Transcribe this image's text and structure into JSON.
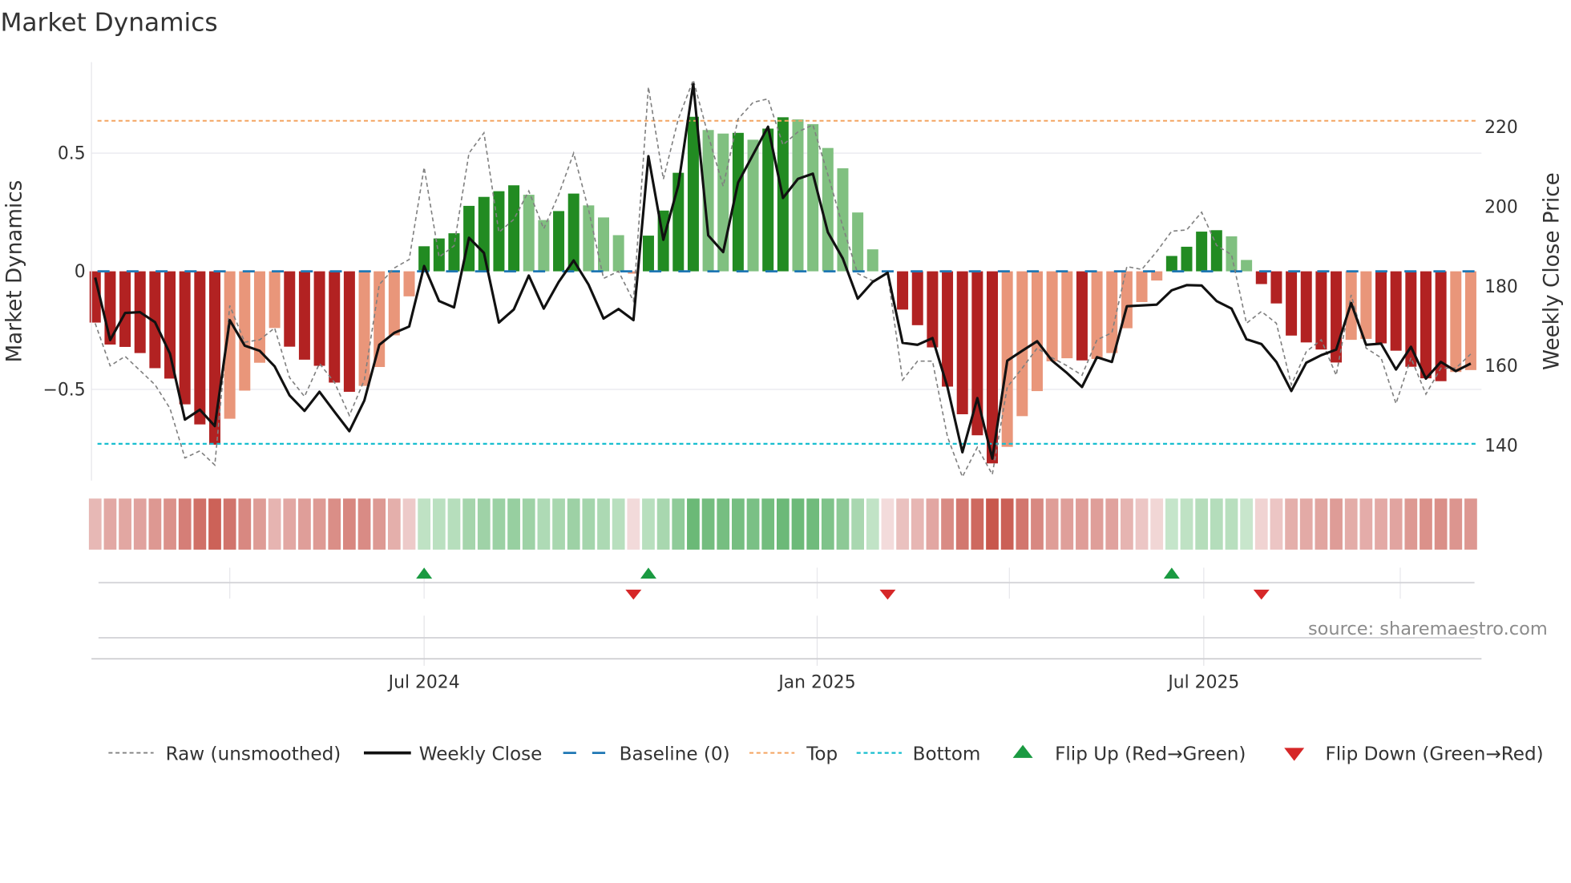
{
  "title": "Market Dynamics",
  "source": "source: sharemaestro.com",
  "colors": {
    "bar_neg_strong": "#b22222",
    "bar_neg_weak": "#e9967a",
    "bar_pos_strong": "#228b22",
    "bar_pos_weak": "#80c080",
    "baseline": "#1f77b4",
    "top": "#f4a460",
    "bottom": "#17becf",
    "close": "#111111",
    "raw": "#808080",
    "flip_up": "#1a9a41",
    "flip_down": "#d62728"
  },
  "legend": [
    {
      "key": "raw",
      "label": "Raw (unsmoothed)"
    },
    {
      "key": "close",
      "label": "Weekly Close"
    },
    {
      "key": "baseline",
      "label": "Baseline (0)"
    },
    {
      "key": "top",
      "label": "Top"
    },
    {
      "key": "bottom",
      "label": "Bottom"
    },
    {
      "key": "flip_up",
      "label": "Flip Up (Red→Green)"
    },
    {
      "key": "flip_down",
      "label": "Flip Down (Green→Red)"
    }
  ],
  "chart_data": {
    "type": "bar",
    "title": "Market Dynamics",
    "ylabel": "Market Dynamics",
    "y2label": "Weekly Close Price",
    "xlabel": "",
    "x_start_week": "2024-01-29",
    "x_interval": "weekly",
    "ylim": [
      -0.9,
      0.87
    ],
    "y_ticks": [
      -0.5,
      0,
      0.5
    ],
    "y_tick_labels": [
      "−0.5",
      "0",
      "0.5"
    ],
    "y2_ticks": [
      140,
      160,
      180,
      200,
      220
    ],
    "y2_tick_labels": [
      "140",
      "160",
      "180",
      "200",
      "220"
    ],
    "x_ticks": [
      {
        "date": "2024-07-01",
        "label": "Jul 2024"
      },
      {
        "date": "2025-01-01",
        "label": "Jan 2025"
      },
      {
        "date": "2025-07-01",
        "label": "Jul 2025"
      }
    ],
    "x_minor_ticks": [
      "2024-04-01",
      "2024-07-01",
      "2025-01-01",
      "2025-04-01",
      "2025-07-01",
      "2025-10-01"
    ],
    "baseline": 0,
    "top": 0.637,
    "bottom": -0.73,
    "grid": true,
    "legend_position": "bottom",
    "series": [
      {
        "name": "Market Dynamics (smoothed)",
        "type": "bar",
        "values": [
          -0.217,
          -0.31,
          -0.32,
          -0.346,
          -0.41,
          -0.454,
          -0.563,
          -0.648,
          -0.734,
          -0.624,
          -0.505,
          -0.387,
          -0.24,
          -0.319,
          -0.374,
          -0.4,
          -0.471,
          -0.51,
          -0.485,
          -0.405,
          -0.271,
          -0.106,
          0.106,
          0.139,
          0.161,
          0.277,
          0.315,
          0.339,
          0.364,
          0.324,
          0.217,
          0.255,
          0.329,
          0.279,
          0.228,
          0.153,
          -0.01,
          0.151,
          0.257,
          0.417,
          0.654,
          0.598,
          0.583,
          0.586,
          0.557,
          0.604,
          0.652,
          0.643,
          0.623,
          0.522,
          0.436,
          0.249,
          0.093,
          -0.005,
          -0.162,
          -0.228,
          -0.322,
          -0.488,
          -0.605,
          -0.694,
          -0.813,
          -0.743,
          -0.613,
          -0.507,
          -0.381,
          -0.368,
          -0.377,
          -0.371,
          -0.346,
          -0.241,
          -0.13,
          -0.039,
          0.065,
          0.104,
          0.168,
          0.174,
          0.148,
          0.048,
          -0.054,
          -0.136,
          -0.272,
          -0.301,
          -0.331,
          -0.386,
          -0.29,
          -0.286,
          -0.305,
          -0.336,
          -0.404,
          -0.453,
          -0.465,
          -0.426,
          -0.418
        ]
      },
      {
        "name": "Raw (unsmoothed)",
        "type": "line",
        "values": [
          -0.22,
          -0.4,
          -0.36,
          -0.42,
          -0.48,
          -0.58,
          -0.79,
          -0.76,
          -0.82,
          -0.145,
          -0.3,
          -0.29,
          -0.24,
          -0.45,
          -0.53,
          -0.39,
          -0.47,
          -0.61,
          -0.46,
          -0.056,
          0.014,
          0.05,
          0.44,
          0.06,
          0.108,
          0.5,
          0.586,
          0.165,
          0.22,
          0.34,
          0.18,
          0.325,
          0.5,
          0.26,
          -0.03,
          0.0,
          -0.126,
          0.78,
          0.39,
          0.645,
          0.81,
          0.575,
          0.36,
          0.645,
          0.715,
          0.73,
          0.535,
          0.59,
          0.62,
          0.41,
          0.19,
          -0.01,
          -0.04,
          -0.01,
          -0.46,
          -0.38,
          -0.38,
          -0.7,
          -0.87,
          -0.745,
          -0.86,
          -0.49,
          -0.41,
          -0.325,
          -0.366,
          -0.4,
          -0.44,
          -0.29,
          -0.26,
          0.02,
          0.008,
          0.084,
          0.17,
          0.175,
          0.25,
          0.11,
          0.07,
          -0.22,
          -0.17,
          -0.22,
          -0.48,
          -0.34,
          -0.29,
          -0.44,
          -0.1,
          -0.325,
          -0.366,
          -0.56,
          -0.366,
          -0.52,
          -0.41,
          -0.41,
          -0.35
        ]
      },
      {
        "name": "Weekly Close",
        "type": "line",
        "axis": "right",
        "values": [
          182.2,
          166.5,
          173.3,
          173.5,
          171.0,
          163.1,
          146.5,
          149.0,
          144.9,
          171.5,
          165.1,
          163.8,
          159.9,
          152.6,
          148.7,
          153.5,
          148.5,
          143.6,
          151.3,
          165.3,
          168.3,
          169.9,
          185.1,
          176.3,
          174.7,
          192.2,
          188.4,
          170.9,
          174.2,
          182.7,
          174.4,
          181.1,
          186.5,
          180.4,
          171.9,
          174.3,
          171.5,
          212.7,
          191.7,
          205.4,
          230.8,
          192.8,
          188.6,
          206.1,
          213.1,
          220.1,
          202.2,
          207.0,
          208.3,
          193.6,
          187.0,
          176.9,
          181.1,
          183.4,
          165.8,
          165.3,
          167.0,
          154.7,
          138.3,
          151.9,
          136.7,
          161.3,
          163.8,
          166.2,
          161.3,
          158.2,
          154.7,
          162.2,
          161.0,
          175.0,
          175.2,
          175.4,
          179.0,
          180.3,
          180.2,
          176.3,
          174.4,
          166.7,
          165.5,
          161.0,
          153.7,
          160.8,
          162.7,
          164.1,
          175.8,
          165.3,
          165.6,
          159.1,
          164.8,
          156.8,
          161.0,
          158.7,
          160.6
        ]
      }
    ]
  }
}
